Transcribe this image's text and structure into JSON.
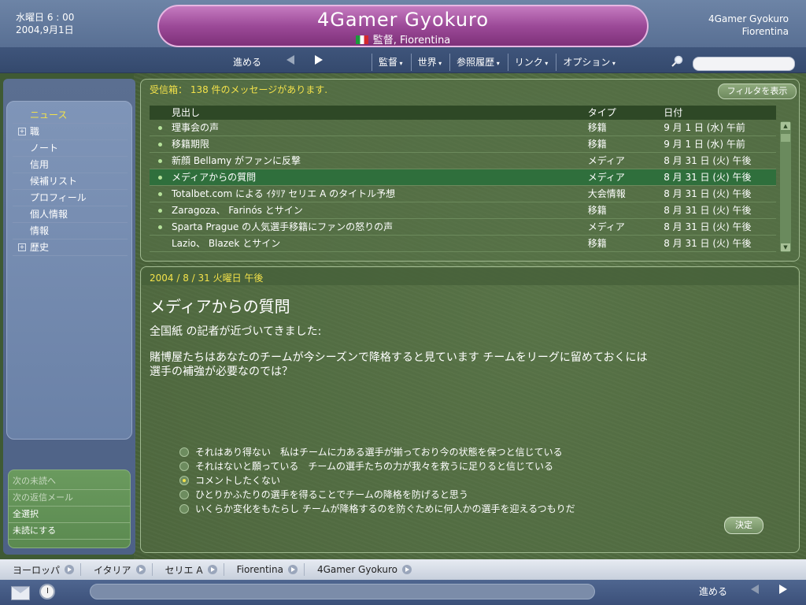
{
  "header": {
    "day_time": "水曜日 6 : 00",
    "date": "2004,9月1日",
    "manager_name": "4Gamer Gyokuro",
    "role_club": "監督, Fiorentina",
    "right_name": "4Gamer Gyokuro",
    "right_club": "Fiorentina"
  },
  "toolbar": {
    "continue_label": "進める",
    "menus": [
      "監督",
      "世界",
      "参照履歴",
      "リンク",
      "オプション"
    ],
    "search_placeholder": ""
  },
  "sidebar": {
    "items": [
      {
        "label": "ニュース",
        "active": true,
        "expandable": false
      },
      {
        "label": "職",
        "active": false,
        "expandable": true
      },
      {
        "label": "ノート",
        "active": false,
        "expandable": false
      },
      {
        "label": "信用",
        "active": false,
        "expandable": false
      },
      {
        "label": "候補リスト",
        "active": false,
        "expandable": false
      },
      {
        "label": "プロフィール",
        "active": false,
        "expandable": false
      },
      {
        "label": "個人情報",
        "active": false,
        "expandable": false
      },
      {
        "label": "情報",
        "active": false,
        "expandable": false
      },
      {
        "label": "歴史",
        "active": false,
        "expandable": true
      }
    ],
    "actions": [
      {
        "label": "次の未読へ",
        "enabled": false
      },
      {
        "label": "次の返信メール",
        "enabled": false
      },
      {
        "label": "全選択",
        "enabled": true
      },
      {
        "label": "未読にする",
        "enabled": true
      }
    ]
  },
  "inbox": {
    "title": "受信箱： 138 件のメッセージがあります.",
    "filter_label": "フィルタを表示",
    "columns": [
      "見出し",
      "タイプ",
      "日付"
    ],
    "rows": [
      {
        "headline": "理事会の声",
        "type": "移籍",
        "date": "9 月 1 日 (水) 午前",
        "selected": false
      },
      {
        "headline": "移籍期限",
        "type": "移籍",
        "date": "9 月 1 日 (水) 午前",
        "selected": false
      },
      {
        "headline": "新顔 Bellamy がファンに反撃",
        "type": "メディア",
        "date": "8 月 31 日 (火) 午後",
        "selected": false
      },
      {
        "headline": "メディアからの質問",
        "type": "メディア",
        "date": "8 月 31 日 (火) 午後",
        "selected": true
      },
      {
        "headline": "Totalbet.com による ｲﾀﾘｱ セリエ A のタイトル予想",
        "type": "大会情報",
        "date": "8 月 31 日 (火) 午後",
        "selected": false
      },
      {
        "headline": "Zaragoza、 Farinós とサイン",
        "type": "移籍",
        "date": "8 月 31 日 (火) 午後",
        "selected": false
      },
      {
        "headline": "Sparta Prague の人気選手移籍にファンの怒りの声",
        "type": "メディア",
        "date": "8 月 31 日 (火) 午後",
        "selected": false
      },
      {
        "headline": "Lazio、 Blazek とサイン",
        "type": "移籍",
        "date": "8 月 31 日 (火) 午後",
        "selected": false
      }
    ]
  },
  "message": {
    "date": "2004 / 8 / 31 火曜日 午後",
    "subject": "メディアからの質問",
    "from": "全国紙 の記者が近づいてきました:",
    "body_line1": "賭博屋たちはあなたのチームが今シーズンで降格すると見ています チームをリーグに留めておくには",
    "body_line2": "選手の補強が必要なのでは？",
    "options": [
      {
        "label": "それはあり得ない　私はチームに力ある選手が揃っており今の状態を保つと信じている",
        "selected": false
      },
      {
        "label": "それはないと願っている　チームの選手たちの力が我々を救うに足りると信じている",
        "selected": false
      },
      {
        "label": "コメントしたくない",
        "selected": true
      },
      {
        "label": "ひとりかふたりの選手を得ることでチームの降格を防げると思う",
        "selected": false
      },
      {
        "label": "いくらか変化をもたらし チームが降格するのを防ぐために何人かの選手を迎えるつもりだ",
        "selected": false
      }
    ],
    "decide_label": "決定"
  },
  "breadcrumb": [
    "ヨーロッパ",
    "イタリア",
    "セリエ A",
    "Fiorentina",
    "4Gamer Gyokuro"
  ],
  "statusbar": {
    "continue_label": "進める"
  }
}
